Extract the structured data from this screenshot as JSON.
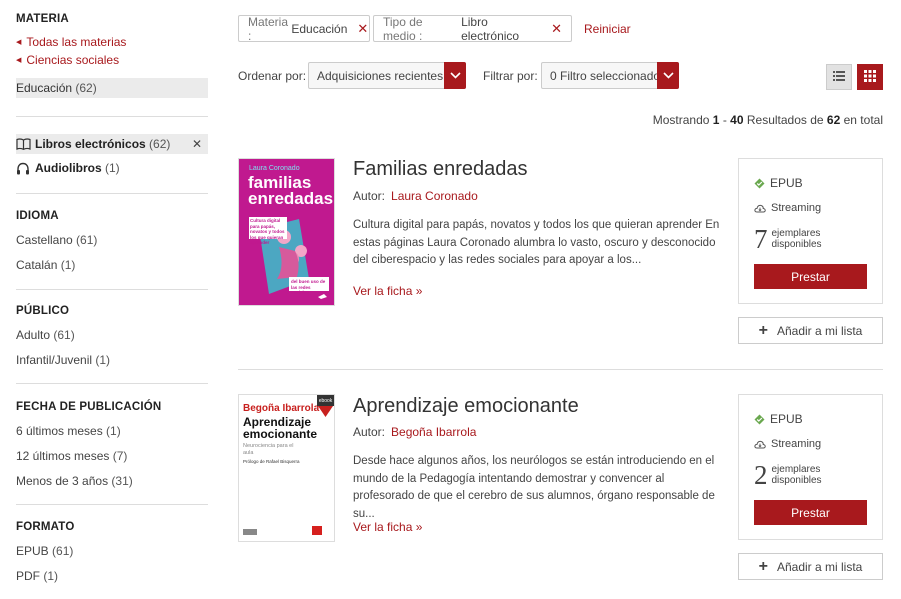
{
  "sidebar": {
    "materia": {
      "title": "MATERIA",
      "crumbs": [
        "Todas las materias",
        "Ciencias sociales"
      ],
      "selected": {
        "label": "Educación",
        "count": "(62)"
      }
    },
    "formats_top": [
      {
        "label": "Libros electrónicos",
        "count": "(62)",
        "icon": "book-icon",
        "selected": true
      },
      {
        "label": "Audiolibros",
        "count": "(1)",
        "icon": "headphones-icon",
        "selected": false
      }
    ],
    "idioma": {
      "title": "IDIOMA",
      "items": [
        {
          "label": "Castellano",
          "count": "(61)"
        },
        {
          "label": "Catalán",
          "count": "(1)"
        }
      ]
    },
    "publico": {
      "title": "PÚBLICO",
      "items": [
        {
          "label": "Adulto",
          "count": "(61)"
        },
        {
          "label": "Infantil/Juvenil",
          "count": "(1)"
        }
      ]
    },
    "fecha": {
      "title": "FECHA DE PUBLICACIÓN",
      "items": [
        {
          "label": "6 últimos meses",
          "count": "(1)"
        },
        {
          "label": "12 últimos meses",
          "count": "(7)"
        },
        {
          "label": "Menos de 3 años",
          "count": "(31)"
        }
      ]
    },
    "formato": {
      "title": "FORMATO",
      "items": [
        {
          "label": "EPUB",
          "count": "(61)"
        },
        {
          "label": "PDF",
          "count": "(1)"
        }
      ]
    }
  },
  "filters": {
    "chips": [
      {
        "key": "Materia :",
        "value": "Educación"
      },
      {
        "key": "Tipo de medio :",
        "value": "Libro electrónico"
      }
    ],
    "reset": "Reiniciar",
    "sort_label": "Ordenar por:",
    "sort_value": "Adquisiciones recientes",
    "filter_label": "Filtrar por:",
    "filter_value": "0 Filtro seleccionado"
  },
  "results_summary": {
    "prefix": "Mostrando",
    "from": "1",
    "dash": "-",
    "to": "40",
    "mid": "Resultados de",
    "total": "62",
    "suffix": "en total"
  },
  "results": [
    {
      "title": "Familias enredadas",
      "author_label": "Autor:",
      "author": "Laura Coronado",
      "description": "Cultura digital para papás, novatos y todos los que quieran aprender En estas páginas Laura Coronado alumbra lo vasto, oscuro y desconocido del ciberespacio y las redes sociales para apoyar a los...",
      "more": "Ver la ficha »",
      "format": "EPUB",
      "streaming": "Streaming",
      "copies": "7",
      "copies_text": "ejemplares disponibles",
      "borrow": "Prestar",
      "add_list": "Añadir a mi lista",
      "cover": {
        "author": "Laura Coronado",
        "title_line1": "familias",
        "title_line2": "enredadas",
        "tagline": "Cultura digital para papás, novatos y todos los que quieran aprender",
        "bottom": "del buen uso de las redes sociales",
        "bg": "#c0198f"
      }
    },
    {
      "title": "Aprendizaje emocionante",
      "author_label": "Autor:",
      "author": "Begoña Ibarrola",
      "description": "Desde hace algunos años, los neurólogos se están introduciendo en el mundo de la Pedagogía intentando demostrar y convencer al profesorado de que el cerebro de sus alumnos, órgano responsable de su...",
      "more": "Ver la ficha »",
      "format": "EPUB",
      "streaming": "Streaming",
      "copies": "2",
      "copies_text": "ejemplares disponibles",
      "borrow": "Prestar",
      "add_list": "Añadir a mi lista",
      "cover": {
        "author": "Begoña Ibarrola",
        "title_line1": "Aprendizaje",
        "title_line2": "emocionante",
        "subtitle": "Neurociencia para el aula",
        "prologue": "Prólogo de Rafael Bisquerra",
        "badge": "ebook",
        "bg": "#ffffff"
      }
    }
  ],
  "colors": {
    "accent": "#a8191d",
    "epub_green": "#6aa84f"
  }
}
